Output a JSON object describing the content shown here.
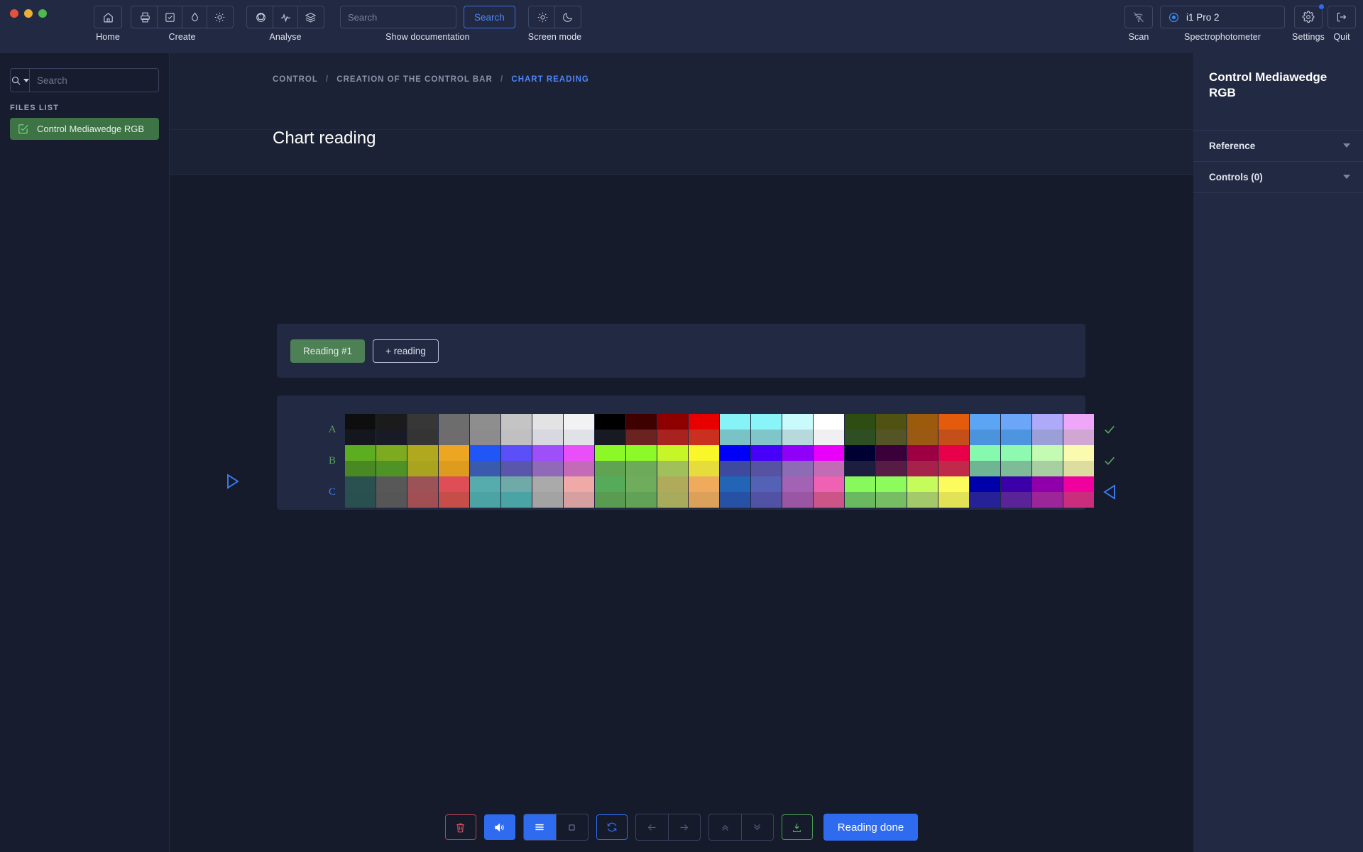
{
  "window": {
    "traffic_lights": [
      "#e0533d",
      "#e8b03a",
      "#4fb84f"
    ]
  },
  "toolbar": {
    "groups": [
      {
        "name": "home",
        "label": "Home",
        "icons": [
          "home-icon"
        ]
      },
      {
        "name": "create",
        "label": "Create",
        "icons": [
          "printer-icon",
          "checklist-icon",
          "droplet-icon",
          "sun-icon"
        ]
      },
      {
        "name": "analyse",
        "label": "Analyse",
        "icons": [
          "globe-icon",
          "pulse-icon",
          "layers-icon"
        ]
      }
    ],
    "documentation": {
      "label": "Show documentation",
      "placeholder": "Search",
      "value": "",
      "button": "Search"
    },
    "screen_mode": {
      "label": "Screen mode",
      "icons": [
        "sun-icon",
        "moon-icon"
      ]
    },
    "scan": {
      "label": "Scan",
      "icon": "scan-off-icon"
    },
    "spectrophotometer": {
      "label": "Spectrophotometer",
      "device": "i1 Pro 2",
      "icon": "radio-selected-icon"
    },
    "settings": {
      "label": "Settings",
      "icon": "gear-icon",
      "has_badge": true
    },
    "quit": {
      "label": "Quit",
      "icon": "logout-icon"
    }
  },
  "sidebar": {
    "search": {
      "placeholder": "Search",
      "value": "",
      "mode_icon": "search-icon"
    },
    "section_label": "FILES LIST",
    "files": [
      {
        "name": "Control Mediawedge RGB",
        "icon": "chart-check-icon",
        "selected": true
      }
    ]
  },
  "breadcrumb": {
    "items": [
      "CONTROL",
      "CREATION OF THE CONTROL BAR",
      "CHART READING"
    ],
    "active_index": 2,
    "separator": "/"
  },
  "page": {
    "title": "Chart reading"
  },
  "readings": {
    "tabs": [
      {
        "label": "Reading #1",
        "selected": true
      },
      {
        "label": "+ reading",
        "selected": false
      }
    ]
  },
  "right_panel": {
    "title": "Control Mediawedge RGB",
    "sections": [
      {
        "label": "Reference",
        "expanded": false
      },
      {
        "label": "Controls (0)",
        "expanded": false
      }
    ]
  },
  "bottom_toolbar": {
    "buttons": [
      {
        "name": "delete-button",
        "icon": "trash-icon",
        "style": "danger-outline"
      },
      {
        "name": "sound-button",
        "icon": "speaker-icon",
        "style": "primary-filled"
      },
      {
        "name": "list-view-button",
        "icon": "list-icon",
        "style": "primary-filled-seg"
      },
      {
        "name": "patch-view-button",
        "icon": "square-icon",
        "style": "seg"
      },
      {
        "name": "refresh-button",
        "icon": "refresh-icon",
        "style": "primary-outline"
      },
      {
        "name": "previous-button",
        "icon": "arrow-left-icon",
        "style": "seg-disabled"
      },
      {
        "name": "next-button",
        "icon": "arrow-right-icon",
        "style": "seg-disabled"
      },
      {
        "name": "page-up-button",
        "icon": "chevrons-up-icon",
        "style": "seg-disabled"
      },
      {
        "name": "page-down-button",
        "icon": "chevrons-down-icon",
        "style": "seg-disabled"
      },
      {
        "name": "export-button",
        "icon": "download-icon",
        "style": "success-outline"
      }
    ],
    "done_label": "Reading done"
  },
  "chart_data": {
    "type": "heatmap",
    "title": "Chart reading",
    "description": "Color chart measurement grid. Each patch shows the reference color (upper half) and the measured color (lower half).",
    "columns": 24,
    "rows": [
      {
        "label": "A",
        "status": "done",
        "status_icon": "check-icon",
        "reference": [
          "#0e0e0e",
          "#1b1b1b",
          "#373737",
          "#6d6d6d",
          "#8e8e8e",
          "#c4c4c4",
          "#e3e3e3",
          "#f2f2f2",
          "#000000",
          "#3f0000",
          "#8e0000",
          "#e80000",
          "#86f3f7",
          "#8af5f8",
          "#c9fbfd",
          "#ffffff",
          "#2e4d12",
          "#4f5210",
          "#9b5a0c",
          "#e25c0b",
          "#5aa6f5",
          "#6ba6f8",
          "#aeaaf9",
          "#eda6f8"
        ],
        "measured": [
          "#15171f",
          "#181b26",
          "#343434",
          "#6e6c6f",
          "#8d8b8d",
          "#c1c0c0",
          "#d8d8e0",
          "#e1e1e8",
          "#171a22",
          "#6a2320",
          "#a8231f",
          "#c9301f",
          "#79c2c6",
          "#80c6c8",
          "#b7d9dc",
          "#f0f0f3",
          "#2e4f24",
          "#545527",
          "#9b5a14",
          "#c44f18",
          "#4b93dc",
          "#4e95e0",
          "#9b9fd8",
          "#cfa7d2"
        ]
      },
      {
        "label": "B",
        "status": "done",
        "status_icon": "check-icon",
        "reference": [
          "#5dad20",
          "#7cab1f",
          "#b0a920",
          "#eda621",
          "#2056f7",
          "#5a4ff9",
          "#9f4ff9",
          "#e94ff9",
          "#8df828",
          "#8cf928",
          "#c7f628",
          "#f9f629",
          "#0000f7",
          "#4700f8",
          "#9000f8",
          "#e800f8",
          "#000033",
          "#3a0039",
          "#9c0043",
          "#e9004b",
          "#86f9ae",
          "#8dfab0",
          "#c2fbb1",
          "#fafbaf"
        ],
        "measured": [
          "#4a8823",
          "#4f9226",
          "#a9a420",
          "#dd9c1e",
          "#3a5aad",
          "#5a56ac",
          "#9069b8",
          "#c46bb7",
          "#5fa353",
          "#6dab5b",
          "#a0c05c",
          "#e6dd3d",
          "#3d4a9d",
          "#5654a2",
          "#8e6cb5",
          "#c16cb4",
          "#1b1e3f",
          "#571c46",
          "#a6224b",
          "#c02949",
          "#6fb594",
          "#7dbc96",
          "#a7cfa1",
          "#ddddA0"
        ]
      },
      {
        "label": "C",
        "status": "active",
        "status_icon": "triangle-left-icon",
        "reference": [
          "#2b5050",
          "#585858",
          "#9b5358",
          "#df4d57",
          "#56acac",
          "#6faaa8",
          "#aaaaaa",
          "#efa9a7",
          "#56ab5a",
          "#6fac5b",
          "#b0ab5b",
          "#efaa5c",
          "#2264b6",
          "#5462b6",
          "#a462b5",
          "#ef61b2",
          "#87f95b",
          "#8cfb5c",
          "#c6fb5c",
          "#fbfb5c",
          "#0000ab",
          "#3c00ab",
          "#9000aa",
          "#ef009f"
        ],
        "measured": [
          "#2a4f4f",
          "#565656",
          "#a14f52",
          "#c74d49",
          "#4ba3a4",
          "#4aa3a4",
          "#a3a3a3",
          "#d6a0a0",
          "#589b51",
          "#62a257",
          "#a9ab5c",
          "#dba059",
          "#2651a5",
          "#5152a4",
          "#9a56a3",
          "#cc5588",
          "#6ab85f",
          "#77bd64",
          "#a4c96a",
          "#e2e257",
          "#262196",
          "#5a2398",
          "#9b2599",
          "#c92d7b"
        ]
      }
    ]
  }
}
